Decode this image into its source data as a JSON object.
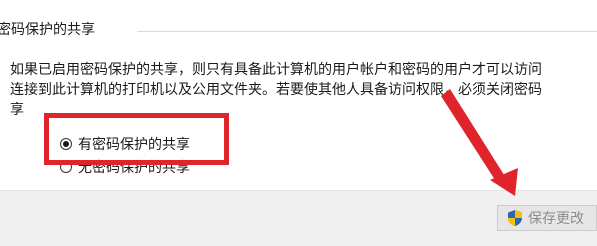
{
  "section": {
    "title": "密码保护的共享"
  },
  "description": {
    "line1": "如果已启用密码保护的共享，则只有具备此计算机的用户帐户和密码的用户才可以访问",
    "line2": "连接到此计算机的打印机以及公用文件夹。若要使其他人具备访问权限，必须关闭密码",
    "line3": "享"
  },
  "options": [
    {
      "label": "有密码保护的共享",
      "selected": true
    },
    {
      "label": "无密码保护的共享",
      "selected": false
    }
  ],
  "footer": {
    "save_label": "保存更改"
  },
  "colors": {
    "annotation_red": "#e0242b",
    "disabled_text": "#8c8c8c"
  },
  "icons": {
    "save": "uac-shield-icon"
  }
}
